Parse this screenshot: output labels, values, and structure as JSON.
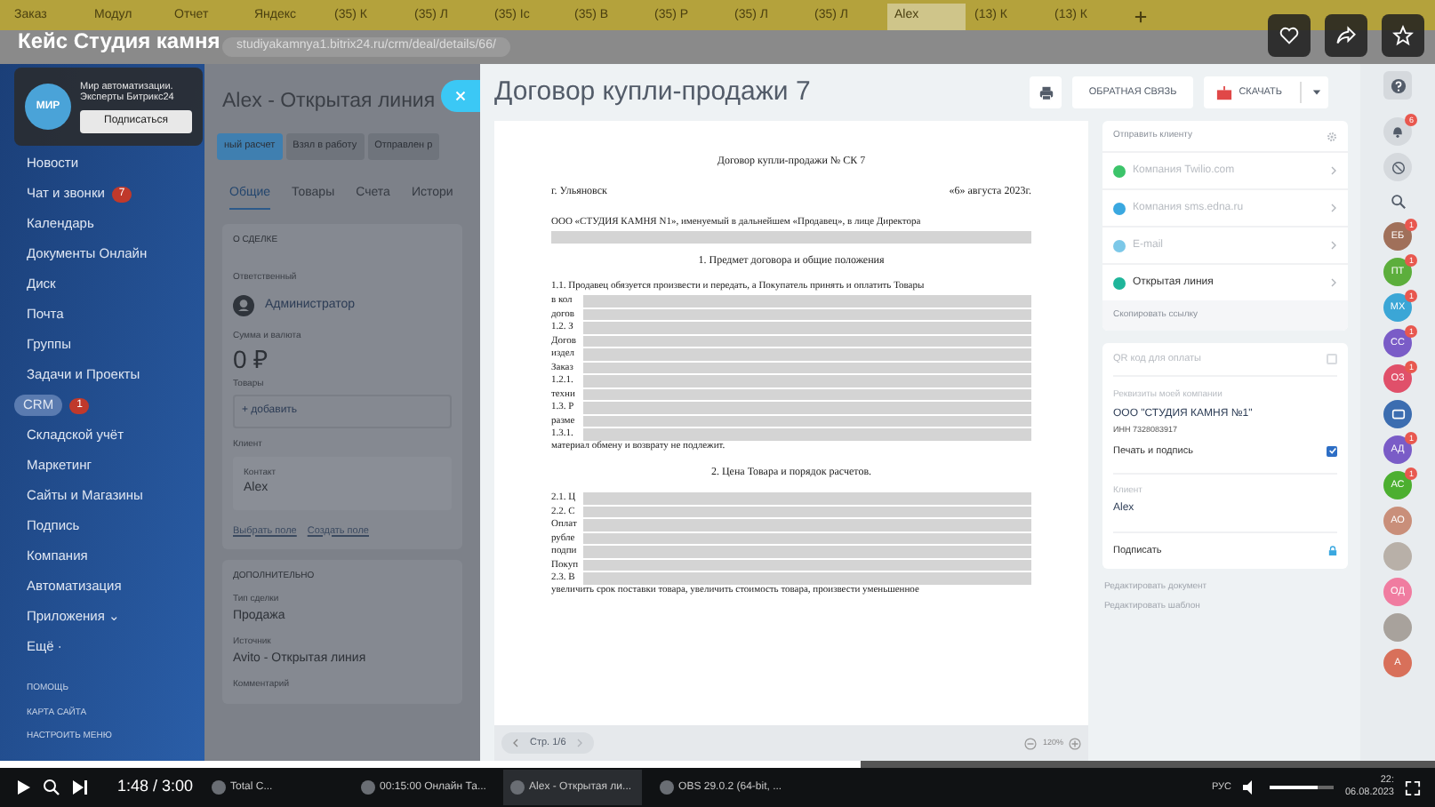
{
  "video": {
    "title": "Кейс Студия камня",
    "time": "1:48 / 3:00",
    "progress": {
      "level": 0.6
    },
    "volume": {
      "level": 0.75
    }
  },
  "browser": {
    "tabs": [
      {
        "label": "Заказ",
        "selected": false
      },
      {
        "label": "Модул",
        "selected": false
      },
      {
        "label": "Отчет",
        "selected": false
      },
      {
        "label": "Яндекс",
        "selected": false
      },
      {
        "label": "(35) К",
        "selected": false
      },
      {
        "label": "(35) Л",
        "selected": false
      },
      {
        "label": "(35) Ic",
        "selected": false
      },
      {
        "label": "(35) В",
        "selected": false
      },
      {
        "label": "(35) Р",
        "selected": false
      },
      {
        "label": "(35) Л",
        "selected": false
      },
      {
        "label": "(35) Л",
        "selected": false
      },
      {
        "label": "Alex",
        "selected": true
      },
      {
        "label": "(13) К",
        "selected": false
      },
      {
        "label": "(13) К",
        "selected": false
      }
    ],
    "address": "studiyakamnya1.bitrix24.ru/crm/deal/details/66/"
  },
  "channel_popup": {
    "logo": "МИР",
    "text": "Мир автоматизации. Эксперты Битрикс24",
    "button": "Подписаться"
  },
  "sidebar": {
    "items": [
      {
        "label": "Новости",
        "selected": false
      },
      {
        "label": "Чат и звонки",
        "badge": "7",
        "selected": false
      },
      {
        "label": "Календарь",
        "selected": false
      },
      {
        "label": "Документы Онлайн",
        "selected": false
      },
      {
        "label": "Диск",
        "selected": false
      },
      {
        "label": "Почта",
        "selected": false
      },
      {
        "label": "Группы",
        "selected": false
      },
      {
        "label": "Задачи и Проекты",
        "selected": false
      },
      {
        "label": "CRM",
        "badge": "1",
        "selected": true
      },
      {
        "label": "Складской учёт",
        "selected": false
      },
      {
        "label": "Маркетинг",
        "selected": false
      },
      {
        "label": "Сайты и Магазины",
        "selected": false
      },
      {
        "label": "Подпись",
        "selected": false
      },
      {
        "label": "Компания",
        "selected": false
      },
      {
        "label": "Автоматизация",
        "selected": false
      },
      {
        "label": "Приложения ⌄",
        "selected": false
      },
      {
        "label": "Ещё ·",
        "selected": false
      }
    ],
    "footer": [
      "ПОМОЩЬ",
      "КАРТА САЙТА",
      "НАСТРОИТЬ МЕНЮ"
    ]
  },
  "deal": {
    "title": "Alex - Открытая линия",
    "stages": [
      {
        "label": "ный расчет",
        "selected": true
      },
      {
        "label": "Взял в работу",
        "selected": false
      },
      {
        "label": "Отправлен р",
        "selected": false
      }
    ],
    "tabs": [
      {
        "label": "Общие",
        "selected": true
      },
      {
        "label": "Товары",
        "selected": false
      },
      {
        "label": "Счета",
        "selected": false
      },
      {
        "label": "Истори",
        "selected": false
      }
    ],
    "about": {
      "heading": "О СДЕЛКЕ",
      "responsible_label": "Ответственный",
      "responsible": "Администратор",
      "sum_label": "Сумма и валюта",
      "sum": "0 ₽",
      "products_label": "Товары",
      "add": "+ добавить",
      "client_label": "Клиент",
      "contact_label": "Контакт",
      "contact": "Alex",
      "links": [
        "Выбрать поле",
        "Создать поле"
      ]
    },
    "extra": {
      "heading": "ДОПОЛНИТЕЛЬНО",
      "fields": [
        {
          "label": "Тип сделки",
          "value": "Продажа"
        },
        {
          "label": "Источник",
          "value": "Avito - Открытая линия"
        },
        {
          "label": "Комментарий"
        }
      ]
    }
  },
  "document_panel": {
    "title": "Договор купли-продажи 7",
    "feedback": "ОБРАТНАЯ СВЯЗЬ",
    "download": "СКАЧАТЬ",
    "page": "Стр. 1/6",
    "zoom": "120%",
    "lines": [
      {
        "kind": "title",
        "text": "Договор купли-продажи № СК 7"
      },
      {
        "kind": "split",
        "text": "г. Ульяновск",
        "right": "«6» августа 2023г."
      },
      {
        "kind": "text",
        "text": "ООО «СТУДИЯ КАМНЯ N1», именуемый в дальнейшем «Продавец», в лице Директора"
      },
      {
        "kind": "redacted"
      },
      {
        "kind": "heading",
        "text": "1. Предмет договора и общие положения"
      },
      {
        "kind": "text",
        "text": "1.1. Продавец обязуется произвести и передать, а Покупатель принять и оплатить Товары"
      },
      {
        "kind": "redacted",
        "text": "в кол"
      },
      {
        "kind": "redacted",
        "text": "догов"
      },
      {
        "kind": "redacted",
        "text": "1.2. З"
      },
      {
        "kind": "redacted",
        "text": "Догов"
      },
      {
        "kind": "redacted",
        "text": "издел"
      },
      {
        "kind": "redacted",
        "text": "Заказ"
      },
      {
        "kind": "redacted",
        "text": "1.2.1."
      },
      {
        "kind": "redacted",
        "text": "техни"
      },
      {
        "kind": "redacted",
        "text": "1.3. Р"
      },
      {
        "kind": "redacted",
        "text": "разме"
      },
      {
        "kind": "redacted",
        "text": "1.3.1."
      },
      {
        "kind": "text",
        "text": "материал обмену и возврату не подлежит."
      },
      {
        "kind": "heading",
        "text": "2. Цена Товара и порядок расчетов."
      },
      {
        "kind": "redacted",
        "text": "2.1. Ц"
      },
      {
        "kind": "redacted",
        "text": "2.2. С"
      },
      {
        "kind": "redacted",
        "text": "Оплат"
      },
      {
        "kind": "redacted",
        "text": "рубле"
      },
      {
        "kind": "redacted",
        "text": "подпи"
      },
      {
        "kind": "redacted",
        "text": "Покуп"
      },
      {
        "kind": "redacted",
        "text": "2.3. В"
      },
      {
        "kind": "text",
        "text": "увеличить срок поставки товара, увеличить стоимость товара, произвести уменьшенное"
      }
    ]
  },
  "send_panel": {
    "heading": "Отправить клиенту",
    "channels": [
      {
        "label": "Компания Twilio.com",
        "disabled": true,
        "color": "#3cc46a"
      },
      {
        "label": "Компания sms.edna.ru",
        "disabled": true,
        "color": "#3aa8e0"
      },
      {
        "label": "E-mail",
        "disabled": true,
        "color": "#7cc8e8"
      },
      {
        "label": "Открытая линия",
        "disabled": false,
        "color": "#1fb59a"
      }
    ],
    "copy_link": "Скопировать ссылку"
  },
  "settings_panel": {
    "qr_label": "QR код для оплаты",
    "qr_checked": false,
    "requisites_label": "Реквизиты моей компании",
    "company": "ООО \"СТУДИЯ КАМНЯ №1\"",
    "inn": "ИНН 7328083917",
    "stamp_label": "Печать и подпись",
    "stamp_checked": true,
    "client_label": "Клиент",
    "client": "Alex",
    "sign": "Подписать"
  },
  "edit_links": [
    "Редактировать документ",
    "Редактировать шаблон"
  ],
  "right_bar": {
    "bell_badge": "6",
    "avatars": [
      {
        "kind": "initials",
        "text": "ЕБ",
        "color": "#a0705a",
        "badge": "1"
      },
      {
        "kind": "initials",
        "text": "ПТ",
        "color": "#5cae3c",
        "badge": "1"
      },
      {
        "kind": "initials",
        "text": "МХ",
        "color": "#3ba6d6",
        "badge": "1"
      },
      {
        "kind": "initials",
        "text": "СС",
        "color": "#7a5cc7",
        "badge": "1"
      },
      {
        "kind": "initials",
        "text": "ОЗ",
        "color": "#e0506a",
        "badge": "1"
      },
      {
        "kind": "chat",
        "color": "#3c6db0"
      },
      {
        "kind": "initials",
        "text": "АД",
        "color": "#7a5cc7",
        "badge": "1"
      },
      {
        "kind": "initials",
        "text": "АС",
        "color": "#4caf30",
        "badge": "1"
      },
      {
        "kind": "initials",
        "text": "АО",
        "color": "#c98f7a"
      },
      {
        "kind": "photo",
        "color": "#b8b0a8"
      },
      {
        "kind": "initials",
        "text": "ОД",
        "color": "#f07ca0"
      },
      {
        "kind": "photo",
        "color": "#a8a29c"
      },
      {
        "kind": "initials",
        "text": "А",
        "color": "#d8705a"
      }
    ]
  },
  "taskbar": {
    "apps": [
      "Total C...",
      "00:15:00 Онлайн Та...",
      "Alex - Открытая ли...",
      "OBS 29.0.2 (64-bit, ..."
    ],
    "lang": "РУС",
    "time": "22:",
    "date": "06.08.2023"
  }
}
